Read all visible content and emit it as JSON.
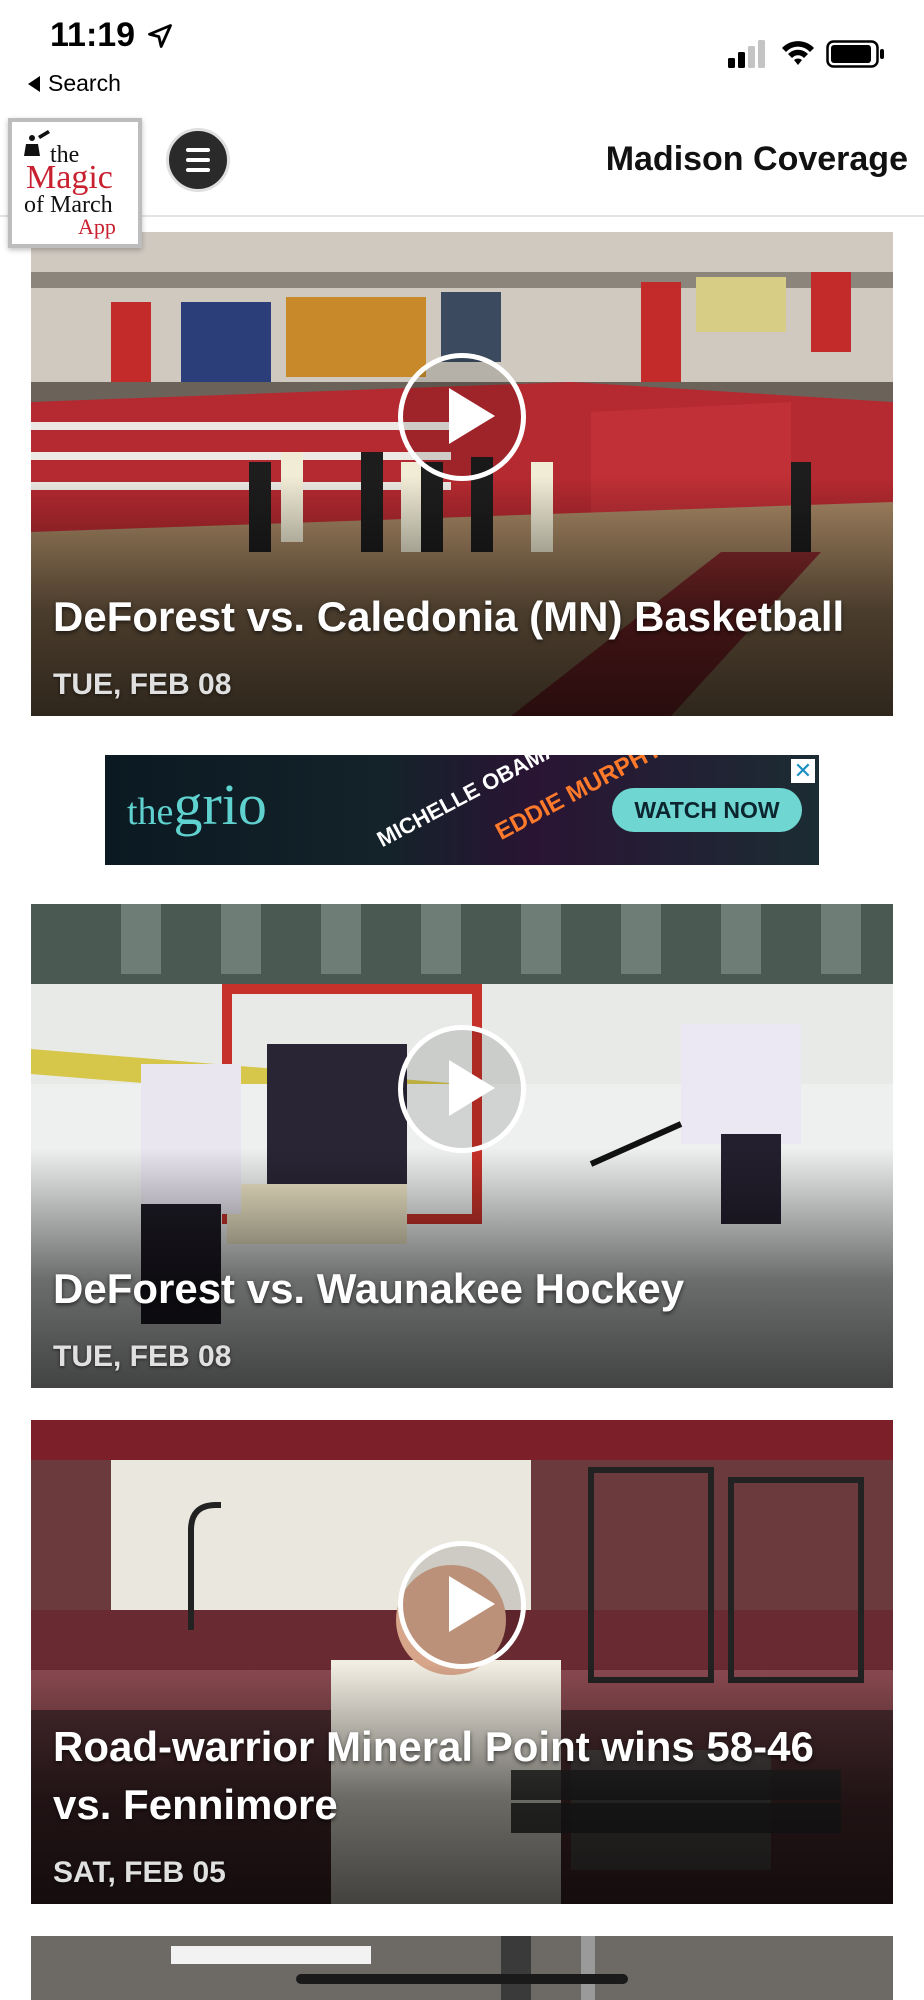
{
  "status_bar": {
    "time": "11:19",
    "back_label": "Search"
  },
  "header": {
    "logo": {
      "line1": "the",
      "line2": "Magic",
      "line3": "of March",
      "line4": "App"
    },
    "title": "Madison Coverage"
  },
  "ad": {
    "brand_main": "the",
    "brand_accent": "grio",
    "text1": "MICHELLE OBAMA",
    "text2": "EDDIE MURPHY",
    "cta": "WATCH NOW",
    "close": "✕"
  },
  "videos": [
    {
      "title": "DeForest vs. Caledonia (MN) Basketball",
      "date": "TUE, FEB 08"
    },
    {
      "title": "DeForest vs. Waunakee Hockey",
      "date": "TUE, FEB 08"
    },
    {
      "title": "Road-warrior Mineral Point wins 58-46 vs. Fennimore",
      "date": "SAT, FEB 05"
    }
  ],
  "colors": {
    "logo_red": "#c8202f",
    "accent_teal": "#6fd6d2"
  }
}
